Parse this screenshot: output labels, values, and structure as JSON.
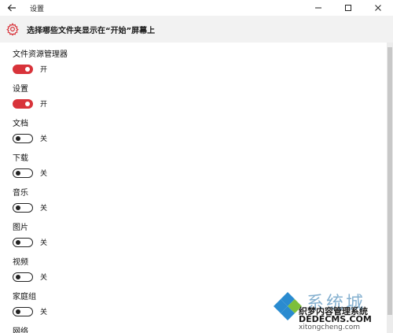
{
  "window": {
    "title": "设置"
  },
  "header": {
    "title": "选择哪些文件夹显示在“开始”屏幕上"
  },
  "items": [
    {
      "label": "文件资源管理器",
      "state": "开",
      "on": true
    },
    {
      "label": "设置",
      "state": "开",
      "on": true
    },
    {
      "label": "文档",
      "state": "关",
      "on": false
    },
    {
      "label": "下载",
      "state": "关",
      "on": false
    },
    {
      "label": "音乐",
      "state": "关",
      "on": false
    },
    {
      "label": "图片",
      "state": "关",
      "on": false
    },
    {
      "label": "视频",
      "state": "关",
      "on": false
    },
    {
      "label": "家庭组",
      "state": "关",
      "on": false
    },
    {
      "label": "网络",
      "state": "",
      "on": false
    }
  ],
  "colors": {
    "accent": "#d8333a",
    "header_band": "#f2f2f2"
  },
  "icons": {
    "back": "back-arrow-icon",
    "settings": "gear-icon",
    "minimize": "minimize-icon",
    "maximize": "maximize-icon",
    "close": "close-icon"
  },
  "watermark": {
    "big": "系统城",
    "line1": "织梦内容管理系统",
    "line2": "DEDECMS.COM",
    "line3": "xitongcheng.com"
  }
}
